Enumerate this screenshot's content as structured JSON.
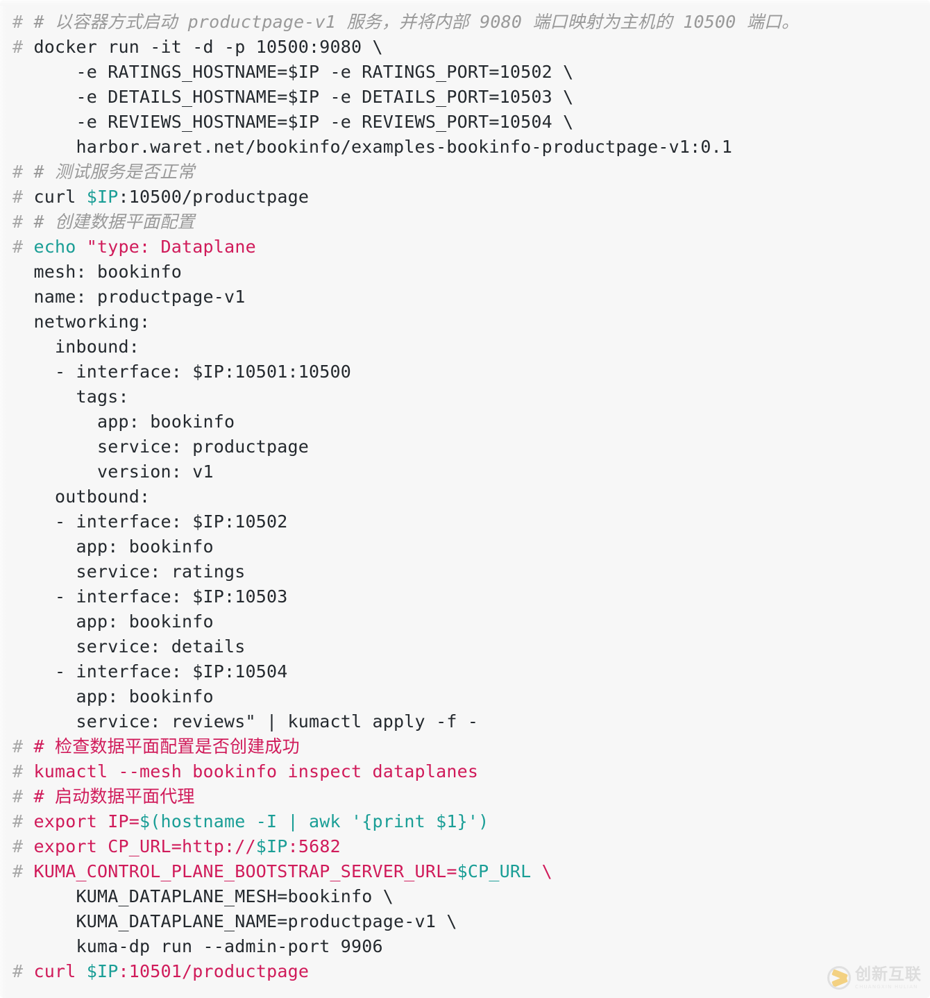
{
  "block": {
    "background_color": "#f7f7f7",
    "default_text_color": "#24292e",
    "prompt_symbol": "#",
    "colors": {
      "prompt": "#a8a8a8",
      "comment": "#999999",
      "comment_red": "#d01b5a",
      "command_red": "#d01b5a",
      "string_red": "#d01b5a",
      "variable_teal": "#1a9e96",
      "keyword_teal": "#1a9e96",
      "plain": "#24292e"
    }
  },
  "lines": [
    {
      "id": "l01",
      "prompt": true,
      "tokens": [
        {
          "t": "# 以容器方式启动 productpage-v1 服务，并将内部 9080 端口映射为主机的 10500 端口。",
          "c": "comment"
        }
      ]
    },
    {
      "id": "l02",
      "prompt": true,
      "tokens": [
        {
          "t": "docker run -it -d -p 10500:9080 \\",
          "c": "plain"
        }
      ]
    },
    {
      "id": "l03",
      "prompt": false,
      "tokens": [
        {
          "t": "    -e RATINGS_HOSTNAME=$IP -e RATINGS_PORT=10502 \\",
          "c": "plain"
        }
      ]
    },
    {
      "id": "l04",
      "prompt": false,
      "tokens": [
        {
          "t": "    -e DETAILS_HOSTNAME=$IP -e DETAILS_PORT=10503 \\",
          "c": "plain"
        }
      ]
    },
    {
      "id": "l05",
      "prompt": false,
      "tokens": [
        {
          "t": "    -e REVIEWS_HOSTNAME=$IP -e REVIEWS_PORT=10504 \\",
          "c": "plain"
        }
      ]
    },
    {
      "id": "l06",
      "prompt": false,
      "tokens": [
        {
          "t": "    harbor.waret.net/bookinfo/examples-bookinfo-productpage-v1:0.1",
          "c": "plain"
        }
      ]
    },
    {
      "id": "l07",
      "prompt": true,
      "tokens": [
        {
          "t": "# 测试服务是否正常",
          "c": "comment"
        }
      ]
    },
    {
      "id": "l08",
      "prompt": true,
      "tokens": [
        {
          "t": "curl ",
          "c": "plain"
        },
        {
          "t": "$IP",
          "c": "variable_teal"
        },
        {
          "t": ":10500/productpage",
          "c": "plain"
        }
      ]
    },
    {
      "id": "l09",
      "prompt": true,
      "tokens": [
        {
          "t": "# 创建数据平面配置",
          "c": "comment"
        }
      ]
    },
    {
      "id": "l10",
      "prompt": true,
      "tokens": [
        {
          "t": "echo",
          "c": "keyword_teal"
        },
        {
          "t": " ",
          "c": "plain"
        },
        {
          "t": "\"type: Dataplane",
          "c": "string_red"
        }
      ]
    },
    {
      "id": "l11",
      "prompt": false,
      "tokens": [
        {
          "t": "mesh: bookinfo",
          "c": "plain"
        }
      ]
    },
    {
      "id": "l12",
      "prompt": false,
      "tokens": [
        {
          "t": "name: productpage-v1",
          "c": "plain"
        }
      ]
    },
    {
      "id": "l13",
      "prompt": false,
      "tokens": [
        {
          "t": "networking:",
          "c": "plain"
        }
      ]
    },
    {
      "id": "l14",
      "prompt": false,
      "tokens": [
        {
          "t": "  inbound:",
          "c": "plain"
        }
      ]
    },
    {
      "id": "l15",
      "prompt": false,
      "tokens": [
        {
          "t": "  - interface: $IP:10501:10500",
          "c": "plain"
        }
      ]
    },
    {
      "id": "l16",
      "prompt": false,
      "tokens": [
        {
          "t": "    tags:",
          "c": "plain"
        }
      ]
    },
    {
      "id": "l17",
      "prompt": false,
      "tokens": [
        {
          "t": "      app: bookinfo",
          "c": "plain"
        }
      ]
    },
    {
      "id": "l18",
      "prompt": false,
      "tokens": [
        {
          "t": "      service: productpage",
          "c": "plain"
        }
      ]
    },
    {
      "id": "l19",
      "prompt": false,
      "tokens": [
        {
          "t": "      version: v1",
          "c": "plain"
        }
      ]
    },
    {
      "id": "l20",
      "prompt": false,
      "tokens": [
        {
          "t": "  outbound:",
          "c": "plain"
        }
      ]
    },
    {
      "id": "l21",
      "prompt": false,
      "tokens": [
        {
          "t": "  - interface: $IP:10502",
          "c": "plain"
        }
      ]
    },
    {
      "id": "l22",
      "prompt": false,
      "tokens": [
        {
          "t": "    app: bookinfo",
          "c": "plain"
        }
      ]
    },
    {
      "id": "l23",
      "prompt": false,
      "tokens": [
        {
          "t": "    service: ratings",
          "c": "plain"
        }
      ]
    },
    {
      "id": "l24",
      "prompt": false,
      "tokens": [
        {
          "t": "  - interface: $IP:10503",
          "c": "plain"
        }
      ]
    },
    {
      "id": "l25",
      "prompt": false,
      "tokens": [
        {
          "t": "    app: bookinfo",
          "c": "plain"
        }
      ]
    },
    {
      "id": "l26",
      "prompt": false,
      "tokens": [
        {
          "t": "    service: details",
          "c": "plain"
        }
      ]
    },
    {
      "id": "l27",
      "prompt": false,
      "tokens": [
        {
          "t": "  - interface: $IP:10504",
          "c": "plain"
        }
      ]
    },
    {
      "id": "l28",
      "prompt": false,
      "tokens": [
        {
          "t": "    app: bookinfo",
          "c": "plain"
        }
      ]
    },
    {
      "id": "l29",
      "prompt": false,
      "tokens": [
        {
          "t": "    service: reviews\" | kumactl apply -f -",
          "c": "plain"
        }
      ]
    },
    {
      "id": "l30",
      "prompt": true,
      "tokens": [
        {
          "t": "# 检查数据平面配置是否创建成功",
          "c": "comment_red"
        }
      ]
    },
    {
      "id": "l31",
      "prompt": true,
      "tokens": [
        {
          "t": "kumactl --mesh bookinfo inspect dataplanes",
          "c": "command_red"
        }
      ]
    },
    {
      "id": "l32",
      "prompt": true,
      "tokens": [
        {
          "t": "# 启动数据平面代理",
          "c": "comment_red"
        }
      ]
    },
    {
      "id": "l33",
      "prompt": true,
      "tokens": [
        {
          "t": "export IP=",
          "c": "command_red"
        },
        {
          "t": "$(hostname -I | awk '{print $1}')",
          "c": "variable_teal"
        }
      ]
    },
    {
      "id": "l34",
      "prompt": true,
      "tokens": [
        {
          "t": "export CP_URL=http://",
          "c": "command_red"
        },
        {
          "t": "$IP",
          "c": "variable_teal"
        },
        {
          "t": ":5682",
          "c": "command_red"
        }
      ]
    },
    {
      "id": "l35",
      "prompt": true,
      "tokens": [
        {
          "t": "KUMA_CONTROL_PLANE_BOOTSTRAP_SERVER_URL=",
          "c": "command_red"
        },
        {
          "t": "$CP_URL",
          "c": "variable_teal"
        },
        {
          "t": " \\",
          "c": "command_red"
        }
      ]
    },
    {
      "id": "l36",
      "prompt": false,
      "tokens": [
        {
          "t": "    KUMA_DATAPLANE_MESH=bookinfo \\",
          "c": "plain"
        }
      ]
    },
    {
      "id": "l37",
      "prompt": false,
      "tokens": [
        {
          "t": "    KUMA_DATAPLANE_NAME=productpage-v1 \\",
          "c": "plain"
        }
      ]
    },
    {
      "id": "l38",
      "prompt": false,
      "tokens": [
        {
          "t": "    kuma-dp run --admin-port 9906",
          "c": "plain"
        }
      ]
    },
    {
      "id": "l39",
      "prompt": true,
      "tokens": [
        {
          "t": "curl ",
          "c": "command_red"
        },
        {
          "t": "$IP",
          "c": "variable_teal"
        },
        {
          "t": ":10501/productpage",
          "c": "command_red"
        }
      ]
    }
  ],
  "watermark": {
    "cn_text": "创新互联",
    "en_text": "CHUANGXIN HULIAN",
    "mark_color": "#f0b323"
  }
}
